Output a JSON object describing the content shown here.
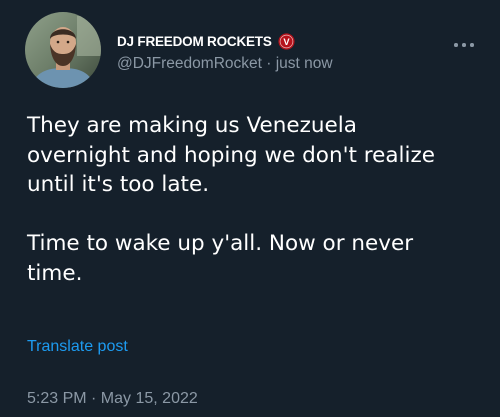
{
  "tweet": {
    "author": {
      "display_name": "DJ FREEDOM ROCKETS",
      "verified_badge_letter": "V",
      "handle": "@DJFreedomRocket",
      "separator": " · ",
      "relative_time": "just now",
      "avatar_icon": "user-avatar-bearded-man"
    },
    "menu_icon": "more-horizontal-icon",
    "text_lines": [
      "They are making us Venezuela",
      "overnight and hoping we don't realize",
      "until it's too late.",
      "",
      "Time to wake up y'all. Now or never",
      "time."
    ],
    "translate_label": "Translate post",
    "timestamp": "5:23 PM · May 15, 2022"
  },
  "colors": {
    "background": "#15202b",
    "text_primary": "#ffffff",
    "text_secondary": "#8b98a5",
    "link": "#1d9bf0",
    "badge": "#b5121b"
  }
}
